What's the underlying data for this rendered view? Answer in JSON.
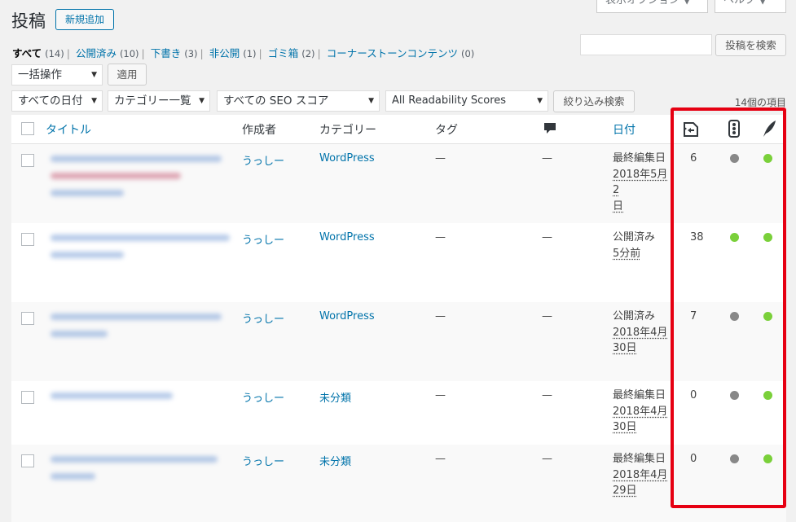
{
  "header": {
    "title": "投稿",
    "new_button": "新規追加",
    "screen_options": "表示オプション ▼",
    "help": "ヘルプ ▼"
  },
  "views": {
    "items": [
      {
        "label": "すべて",
        "count": "(14)"
      },
      {
        "label": "公開済み",
        "count": "(10)"
      },
      {
        "label": "下書き",
        "count": "(3)"
      },
      {
        "label": "非公開",
        "count": "(1)"
      },
      {
        "label": "ゴミ箱",
        "count": "(2)"
      },
      {
        "label": "コーナーストーンコンテンツ",
        "count": "(0)"
      }
    ]
  },
  "search": {
    "button": "投稿を検索"
  },
  "bulk": {
    "select": "一括操作",
    "apply": "適用"
  },
  "filters": {
    "dates": "すべての日付",
    "categories": "カテゴリー一覧",
    "seo": "すべての SEO スコア",
    "readability": "All Readability Scores",
    "filter_button": "絞り込み検索"
  },
  "items_count": "14個の項目",
  "columns": {
    "title": "タイトル",
    "author": "作成者",
    "categories": "カテゴリー",
    "tags": "タグ",
    "date": "日付"
  },
  "colors": {
    "accent": "#0073aa",
    "green": "#7ad03a",
    "gray": "#888888",
    "highlight": "#e60012"
  },
  "icons": {
    "comments": "comment-bubble-icon",
    "links": "internal-links-icon",
    "seo": "traffic-light-icon",
    "readability": "feather-icon"
  },
  "rows": [
    {
      "author": "うっしー",
      "category": "WordPress",
      "tags": "—",
      "comments": "—",
      "date_status": "最終編集日",
      "date_lines": [
        "2018年5月2",
        "日"
      ],
      "links": "6",
      "seo": "gray",
      "readability": "green"
    },
    {
      "author": "うっしー",
      "category": "WordPress",
      "tags": "—",
      "comments": "—",
      "date_status": "公開済み",
      "date_lines": [
        "5分前"
      ],
      "links": "38",
      "seo": "green",
      "readability": "green"
    },
    {
      "author": "うっしー",
      "category": "WordPress",
      "tags": "—",
      "comments": "—",
      "date_status": "公開済み",
      "date_lines": [
        "2018年4月",
        "30日"
      ],
      "links": "7",
      "seo": "gray",
      "readability": "green"
    },
    {
      "author": "うっしー",
      "category": "未分類",
      "tags": "—",
      "comments": "—",
      "date_status": "最終編集日",
      "date_lines": [
        "2018年4月",
        "30日"
      ],
      "links": "0",
      "seo": "gray",
      "readability": "green"
    },
    {
      "author": "うっしー",
      "category": "未分類",
      "tags": "—",
      "comments": "—",
      "date_status": "最終編集日",
      "date_lines": [
        "2018年4月",
        "29日"
      ],
      "links": "0",
      "seo": "gray",
      "readability": "green"
    }
  ]
}
